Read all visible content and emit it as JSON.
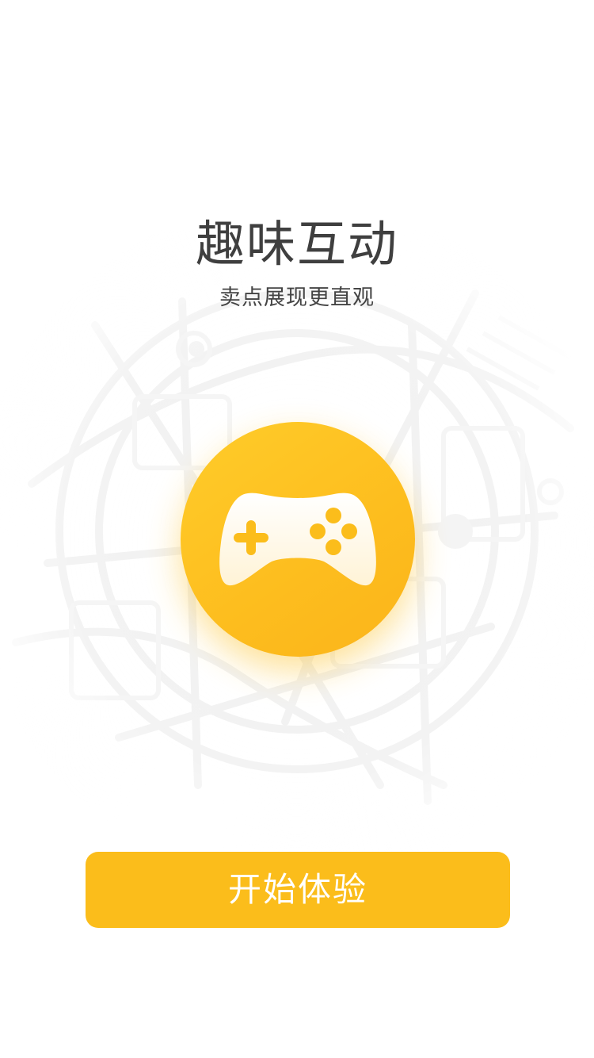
{
  "onboarding": {
    "title": "趣味互动",
    "subtitle": "卖点展现更直观",
    "start_button_label": "开始体验",
    "feature_icon": "gamepad-icon",
    "background_graphic": "city-map-pattern"
  },
  "colors": {
    "accent": "#fbbd1b",
    "title_text": "#3f3f3f",
    "subtitle_text": "#444444",
    "button_text": "#ffffff",
    "background": "#ffffff"
  }
}
